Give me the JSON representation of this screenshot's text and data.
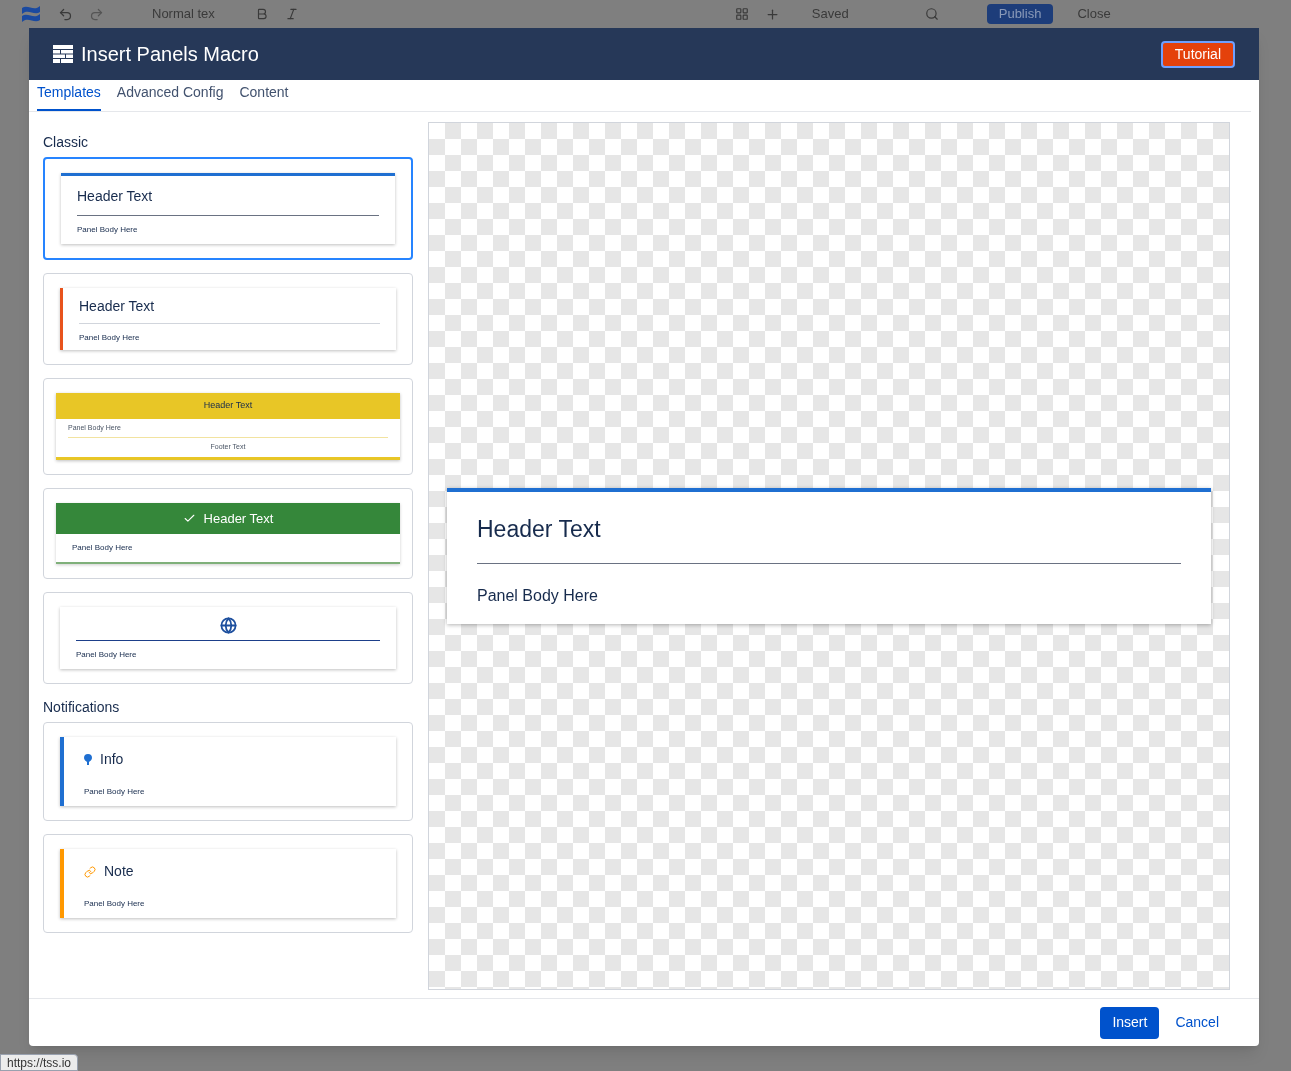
{
  "editor_toolbar": {
    "style_menu": "Normal tex",
    "status": "Saved",
    "publish": "Publish",
    "close": "Close"
  },
  "dialog": {
    "title": "Insert Panels Macro",
    "tutorial": "Tutorial",
    "tabs": [
      {
        "label": "Templates",
        "selected": true
      },
      {
        "label": "Advanced Config",
        "selected": false
      },
      {
        "label": "Content",
        "selected": false
      }
    ],
    "sections": [
      {
        "title": "Classic",
        "templates": [
          {
            "kind": "top-border",
            "header": "Header Text",
            "body": "Panel Body Here",
            "selected": true
          },
          {
            "kind": "left-border",
            "header": "Header Text",
            "body": "Panel Body Here",
            "selected": false
          },
          {
            "kind": "yellow",
            "header": "Header Text",
            "body": "Panel Body Here",
            "footer": "Footer Text",
            "selected": false
          },
          {
            "kind": "green",
            "header": "Header Text",
            "body": "Panel Body Here",
            "selected": false
          },
          {
            "kind": "icon",
            "body": "Panel Body Here",
            "selected": false
          }
        ]
      },
      {
        "title": "Notifications",
        "templates": [
          {
            "kind": "info",
            "header": "Info",
            "body": "Panel Body Here",
            "selected": false
          },
          {
            "kind": "note",
            "header": "Note",
            "body": "Panel Body Here",
            "selected": false
          }
        ]
      }
    ],
    "preview": {
      "header": "Header Text",
      "body": "Panel Body Here"
    },
    "buttons": {
      "insert": "Insert",
      "cancel": "Cancel"
    }
  },
  "status_url": "https://tss.io"
}
